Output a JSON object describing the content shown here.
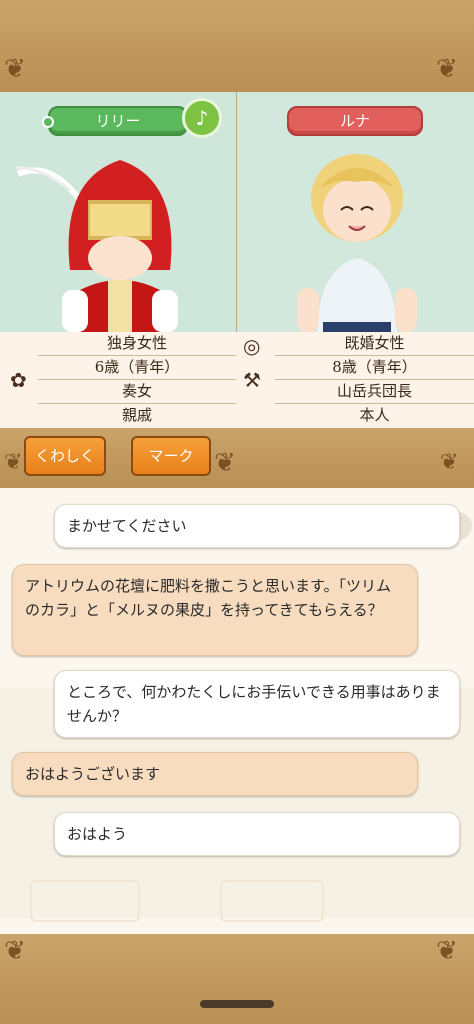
{
  "characters": {
    "left": {
      "name": "リリー",
      "tag_color": "#5cb85c",
      "music_icon": "♪"
    },
    "right": {
      "name": "ルナ",
      "tag_color": "#e1605d"
    }
  },
  "info": {
    "left": {
      "icon": "family-branch-icon",
      "rows": [
        "独身女性",
        "6歳（青年）",
        "奏女",
        "親戚"
      ]
    },
    "right": {
      "icon_top": "ring-icon",
      "icon_bottom": "axe-icon",
      "rows": [
        "既婚女性",
        "8歳（青年）",
        "山岳兵団長",
        "本人"
      ]
    }
  },
  "buttons": {
    "details": "くわしく",
    "mark": "マーク"
  },
  "chat": [
    {
      "side": "me",
      "text": "まかせてください"
    },
    {
      "side": "them",
      "text": "アトリウムの花壇に肥料を撒こうと思います。「ツリムのカラ」と「メルヌの果皮」を持ってきてもらえる？"
    },
    {
      "side": "me",
      "text": "ところで、何かわたくしにお手伝いできる用事はありませんか？"
    },
    {
      "side": "them",
      "text": "おはようございます"
    },
    {
      "side": "me",
      "text": "おはよう"
    }
  ],
  "colors": {
    "accent_orange": "#f08c2a",
    "frame_gold": "#c9a46a",
    "panel_green": "#cfe6da"
  }
}
